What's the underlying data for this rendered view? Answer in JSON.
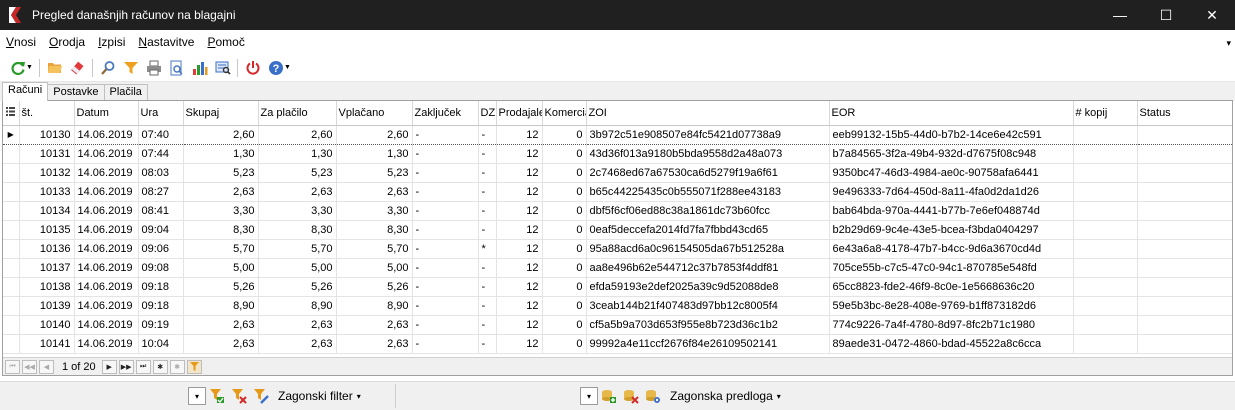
{
  "window": {
    "title": "Pregled današnjih računov na blagajni",
    "minimize_glyph": "—",
    "maximize_glyph": "☐",
    "close_glyph": "✕"
  },
  "menu": {
    "items": [
      {
        "underline": "V",
        "rest": "nosi"
      },
      {
        "underline": "O",
        "rest": "rodja"
      },
      {
        "underline": "I",
        "rest": "zpisi"
      },
      {
        "underline": "N",
        "rest": "astavitve"
      },
      {
        "underline": "P",
        "rest": "omoč"
      }
    ],
    "overflow_glyph": "▾"
  },
  "toolbar": {
    "icons": [
      "refresh-icon",
      "folder-open-icon",
      "eraser-icon",
      "find-icon",
      "filter-icon",
      "print-icon",
      "print-preview-icon",
      "chart-icon",
      "report-search-icon",
      "power-icon",
      "help-icon"
    ]
  },
  "tabs": [
    "Računi",
    "Postavke",
    "Plačila"
  ],
  "grid": {
    "columns": [
      "št.",
      "Datum",
      "Ura",
      "Skupaj",
      "Za plačilo",
      "Vplačano",
      "Zaključek",
      "DZ",
      "Prodajalec",
      "Komercialist",
      "ZOI",
      "EOR",
      "# kopij",
      "Status"
    ],
    "rows": [
      [
        "10130",
        "14.06.2019",
        "07:40",
        "2,60",
        "2,60",
        "2,60",
        "-",
        "-",
        "12",
        "0",
        "3b972c51e908507e84fc5421d07738a9",
        "eeb99132-15b5-44d0-b7b2-14ce6e42c591",
        "",
        ""
      ],
      [
        "10131",
        "14.06.2019",
        "07:44",
        "1,30",
        "1,30",
        "1,30",
        "-",
        "-",
        "12",
        "0",
        "43d36f013a9180b5bda9558d2a48a073",
        "b7a84565-3f2a-49b4-932d-d7675f08c948",
        "",
        ""
      ],
      [
        "10132",
        "14.06.2019",
        "08:03",
        "5,23",
        "5,23",
        "5,23",
        "-",
        "-",
        "12",
        "0",
        "2c7468ed67a67530ca6d5279f19a6f61",
        "9350bc47-46d3-4984-ae0c-90758afa6441",
        "",
        ""
      ],
      [
        "10133",
        "14.06.2019",
        "08:27",
        "2,63",
        "2,63",
        "2,63",
        "-",
        "-",
        "12",
        "0",
        "b65c44225435c0b555071f288ee43183",
        "9e496333-7d64-450d-8a11-4fa0d2da1d26",
        "",
        ""
      ],
      [
        "10134",
        "14.06.2019",
        "08:41",
        "3,30",
        "3,30",
        "3,30",
        "-",
        "-",
        "12",
        "0",
        "dbf5f6cf06ed88c38a1861dc73b60fcc",
        "bab64bda-970a-4441-b77b-7e6ef048874d",
        "",
        ""
      ],
      [
        "10135",
        "14.06.2019",
        "09:04",
        "8,30",
        "8,30",
        "8,30",
        "-",
        "-",
        "12",
        "0",
        "0eaf5deccefa2014fd7fa7fbbd43cd65",
        "b2b29d69-9c4e-43e5-bcea-f3bda0404297",
        "",
        ""
      ],
      [
        "10136",
        "14.06.2019",
        "09:06",
        "5,70",
        "5,70",
        "5,70",
        "-",
        "*",
        "12",
        "0",
        "95a88acd6a0c96154505da67b512528a",
        "6e43a6a8-4178-47b7-b4cc-9d6a3670cd4d",
        "",
        ""
      ],
      [
        "10137",
        "14.06.2019",
        "09:08",
        "5,00",
        "5,00",
        "5,00",
        "-",
        "-",
        "12",
        "0",
        "aa8e496b62e544712c37b7853f4ddf81",
        "705ce55b-c7c5-47c0-94c1-870785e548fd",
        "",
        ""
      ],
      [
        "10138",
        "14.06.2019",
        "09:18",
        "5,26",
        "5,26",
        "5,26",
        "-",
        "-",
        "12",
        "0",
        "efda59193e2def2025a39c9d52088de8",
        "65cc8823-fde2-46f9-8c0e-1e5668636c20",
        "",
        ""
      ],
      [
        "10139",
        "14.06.2019",
        "09:18",
        "8,90",
        "8,90",
        "8,90",
        "-",
        "-",
        "12",
        "0",
        "3ceab144b21f407483d97bb12c8005f4",
        "59e5b3bc-8e28-408e-9769-b1ff873182d6",
        "",
        ""
      ],
      [
        "10140",
        "14.06.2019",
        "09:19",
        "2,63",
        "2,63",
        "2,63",
        "-",
        "-",
        "12",
        "0",
        "cf5a5b9a703d653f955e8b723d36c1b2",
        "774c9226-7a4f-4780-8d97-8fc2b71c1980",
        "",
        ""
      ],
      [
        "10141",
        "14.06.2019",
        "10:04",
        "2,63",
        "2,63",
        "2,63",
        "-",
        "-",
        "12",
        "0",
        "99992a4e11ccf2676f84e26109502141",
        "89aede31-0472-4860-bdad-45522a8c6cca",
        "",
        ""
      ]
    ]
  },
  "navigator": {
    "page_text": "1 of 20",
    "first": "⏮",
    "prev_page": "◀◀",
    "prev": "◀",
    "next": "▶",
    "next_page": "▶▶",
    "last": "⏭",
    "add": "✱",
    "remove": "✱",
    "filter": "▼"
  },
  "bottom": {
    "filter_label": "Zagonski filter",
    "template_label": "Zagonska predloga",
    "combo_glyph": "▾",
    "drop_glyph": "▾"
  },
  "colors": {
    "titlebar": "#202020",
    "accent_green": "#2a9a2a",
    "accent_orange": "#e69a1a",
    "accent_red": "#d22a2a",
    "accent_blue": "#3a6fc9"
  }
}
